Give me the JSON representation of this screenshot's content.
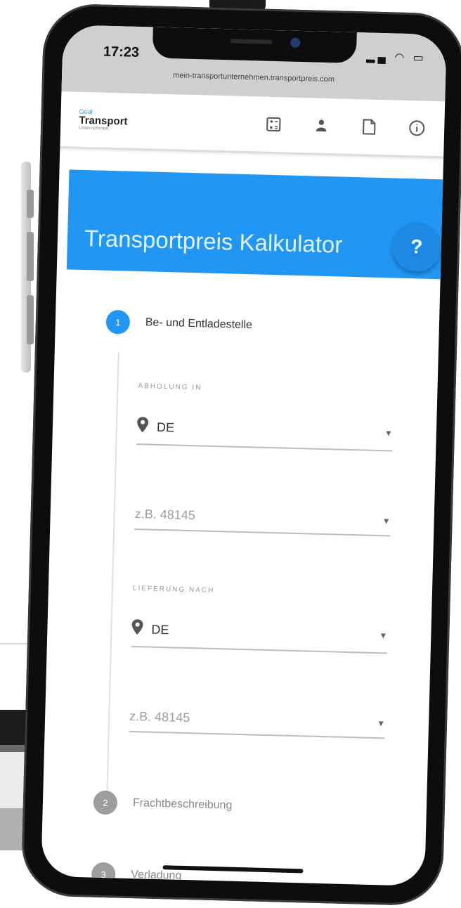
{
  "status_bar": {
    "time": "17:23",
    "url": "mein-transportunternehmen.transportpreis.com"
  },
  "header": {
    "logo": {
      "top": "Goal",
      "main": "Transport",
      "sub": "Unternehmen"
    },
    "icons": [
      "calculator-icon",
      "person-icon",
      "document-icon",
      "info-icon"
    ]
  },
  "hero": {
    "title": "Transportpreis Kalkulator",
    "help_label": "?"
  },
  "steps": [
    {
      "number": "1",
      "label": "Be- und Entladestelle",
      "active": true
    },
    {
      "number": "2",
      "label": "Frachtbeschreibung",
      "active": false
    },
    {
      "number": "3",
      "label": "Verladung",
      "active": false
    }
  ],
  "pickup": {
    "caption": "ABHOLUNG IN",
    "country_value": "DE",
    "zip_placeholder": "z.B. 48145"
  },
  "delivery": {
    "caption": "LIEFERUNG NACH",
    "country_value": "DE",
    "zip_placeholder": "z.B. 48145"
  },
  "colors": {
    "accent": "#2196f3",
    "inactive_step": "#9e9e9e"
  }
}
